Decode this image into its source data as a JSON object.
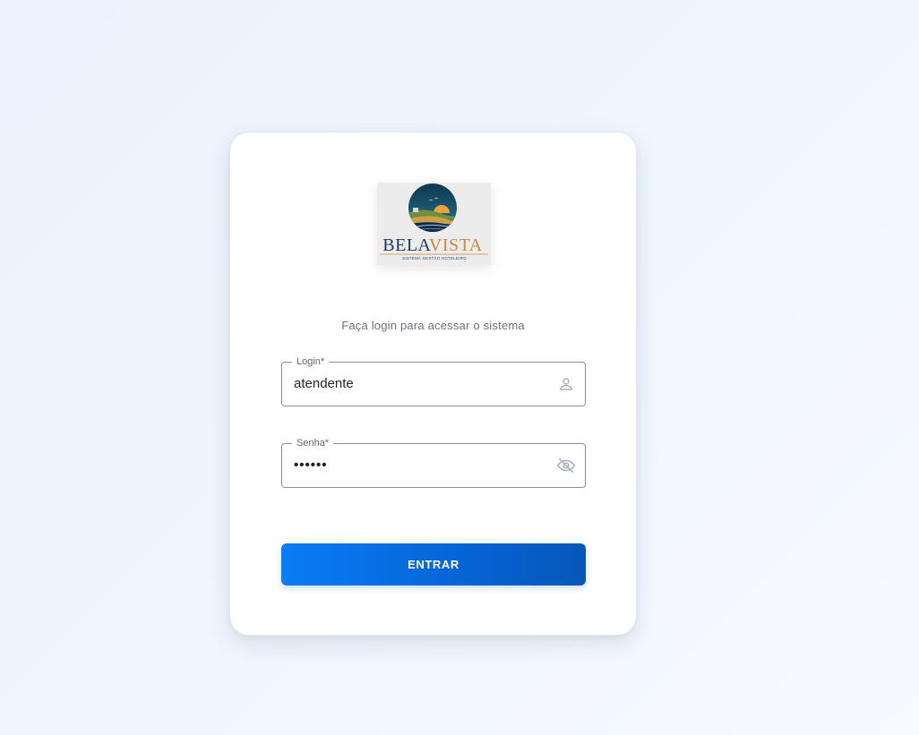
{
  "logo": {
    "brand_part1": "BELA",
    "brand_part2": "VISTA",
    "tagline": "SISTEMA   GESTÃO HOTELEIRO",
    "colors": {
      "navy": "#1f3b63",
      "gold": "#c98a3a",
      "sun": "#f2a23a",
      "sea": "#2f6fa0"
    }
  },
  "subtitle": "Faça login para acessar o sistema",
  "login": {
    "label": "Login*",
    "value": "atendente",
    "icon": "person-icon"
  },
  "senha": {
    "label": "Senha*",
    "value": "••••••",
    "icon": "eye-off-icon"
  },
  "submit": {
    "label": "ENTRAR"
  },
  "colors": {
    "primary": "#0a6fe6",
    "background": "#eef5fe"
  }
}
